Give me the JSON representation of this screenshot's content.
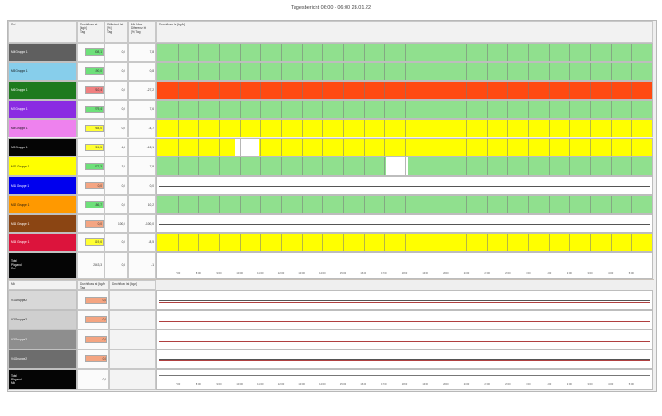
{
  "report_title": "Tagesbericht 06:00 - 06:00   28.01.22",
  "top_section": {
    "headers": {
      "name": "Soll",
      "flow": "Durchfluss Ist [kg/h]",
      "flow_unit": "Tag",
      "stand": "Stillstand Ist [%]",
      "stand_unit": "Tag",
      "diff": "Min-Max-Differenz Ist",
      "diff_unit": "[%] Tag",
      "chart": "Durchfluss Ist [kg/h]"
    },
    "rows": [
      {
        "name": "M4 Gruppe 1",
        "color": "#5f5f5f",
        "flow": "308,1",
        "flow_color": "#6ee07a",
        "stand": "0,0",
        "diff": "7,8",
        "pattern": [
          [
            "#90e08e",
            1
          ]
        ]
      },
      {
        "name": "M5 Gruppe 1",
        "color": "#87ceeb",
        "flow": "190,0",
        "flow_color": "#6ee07a",
        "stand": "0,0",
        "diff": "0,8",
        "pattern": [
          [
            "#90e08e",
            1
          ]
        ]
      },
      {
        "name": "M6 Gruppe 1",
        "color": "#1e7a1e",
        "flow": "210,4",
        "flow_color": "#f08080",
        "stand": "0,0",
        "diff": "-27,2",
        "pattern": [
          [
            "#ff4a12",
            1
          ]
        ]
      },
      {
        "name": "M7 Gruppe 1",
        "color": "#8a2be2",
        "flow": "279,4",
        "flow_color": "#6ee07a",
        "stand": "0,0",
        "diff": "7,6",
        "pattern": [
          [
            "#90e08e",
            1
          ]
        ]
      },
      {
        "name": "M8 Gruppe 1",
        "color": "#ee82ee",
        "flow": "264,0",
        "flow_color": "#ffff33",
        "stand": "0,0",
        "diff": "-4,7",
        "pattern": [
          [
            "#ffff00",
            1
          ]
        ]
      },
      {
        "name": "M9 Gruppe 1",
        "color": "#050505",
        "flow": "224,5",
        "flow_color": "#ffff33",
        "stand": "4,2",
        "diff": "-12,1",
        "pattern": [
          [
            "#ffff00",
            0.157
          ],
          [
            "#ffffff",
            0.048
          ],
          [
            "#ffff00",
            0.795
          ]
        ]
      },
      {
        "name": "M10 Gruppe 1",
        "color": "#ffff00",
        "flow": "377,3",
        "flow_color": "#6ee07a",
        "stand": "3,8",
        "diff": "7,8",
        "pattern": [
          [
            "#90e08e",
            0.463
          ],
          [
            "#ffffff",
            0.045
          ],
          [
            "#90e08e",
            0.492
          ]
        ]
      },
      {
        "name": "M11 Gruppe 1",
        "color": "#0000ee",
        "flow": "0,0",
        "flow_color": "#f4a582",
        "stand": "0,0",
        "diff": "0,0",
        "pattern": [
          [
            "#ffffff",
            1
          ]
        ]
      },
      {
        "name": "M12 Gruppe 1",
        "color": "#ff9900",
        "flow": "186,7",
        "flow_color": "#6ee07a",
        "stand": "0,0",
        "diff": "10,2",
        "pattern": [
          [
            "#90e08e",
            1
          ]
        ]
      },
      {
        "name": "M16 Gruppe 1",
        "color": "#8b4513",
        "flow": "0,0",
        "flow_color": "#f4a582",
        "stand": "100,0",
        "diff": "-100,0",
        "pattern": [
          [
            "#ffffff",
            1
          ]
        ]
      },
      {
        "name": "M14 Gruppe 1",
        "color": "#dc143c",
        "flow": "419,6",
        "flow_color": "#ffff33",
        "stand": "0,0",
        "diff": "-8,5",
        "pattern": [
          [
            "#ffff00",
            1
          ]
        ]
      }
    ],
    "total": {
      "label": "Total\nPlagand\nSoll",
      "flow": "2843,3",
      "stand": "0,8",
      "diff": "-1"
    }
  },
  "bottom_section": {
    "headers": {
      "name": "Mix",
      "flow": "Durchfluss Ist [kg/h] Tag",
      "chart": "Durchfluss Ist [kg/h]"
    },
    "rows": [
      {
        "name": "V1 Gruppe 2",
        "color": "#d8d8d8",
        "flow": "0,0"
      },
      {
        "name": "V2 Gruppe 2",
        "color": "#cfcfcf",
        "flow": "0,0"
      },
      {
        "name": "V3 Gruppe 2",
        "color": "#8e8e8e",
        "flow": "0,0"
      },
      {
        "name": "V4 Gruppe 2",
        "color": "#6d6d6d",
        "flow": "0,0"
      }
    ],
    "total": {
      "label": "Total\nPlagand\nMix",
      "flow": "0,0"
    }
  },
  "time_ticks": [
    "7:00",
    "8:00",
    "9:00",
    "10:00",
    "11:00",
    "12:00",
    "13:00",
    "14:00",
    "15:00",
    "16:00",
    "17:00",
    "18:00",
    "19:00",
    "20:00",
    "21:00",
    "22:00",
    "23:00",
    "0:00",
    "1:00",
    "2:00",
    "3:00",
    "4:00",
    "5:00"
  ]
}
